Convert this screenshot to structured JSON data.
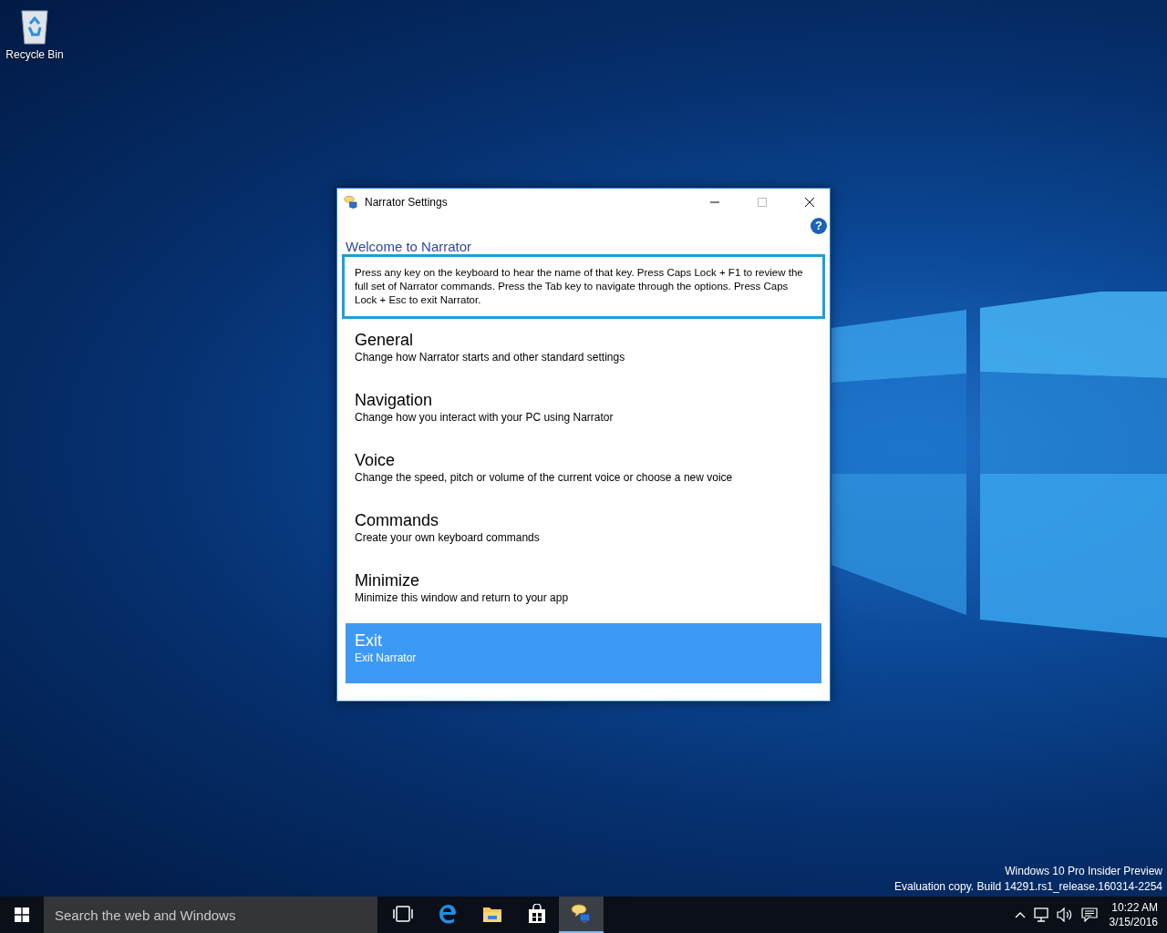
{
  "desktop": {
    "icons": [
      {
        "label": "Recycle Bin"
      }
    ],
    "build_info": [
      "Windows 10 Pro Insider Preview",
      "Evaluation copy. Build 14291.rs1_release.160314-2254"
    ]
  },
  "window": {
    "title": "Narrator Settings",
    "help_button": "?",
    "heading": "Welcome to Narrator",
    "intro": "Press any key on the keyboard to hear the name of that key.  Press Caps Lock + F1 to review the full set of Narrator commands.  Press the Tab key to navigate through the options.  Press Caps Lock + Esc to exit Narrator.",
    "items": [
      {
        "title": "General",
        "description": "Change how Narrator starts and other standard settings",
        "selected": false
      },
      {
        "title": "Navigation",
        "description": "Change how you interact with your PC using Narrator",
        "selected": false
      },
      {
        "title": "Voice",
        "description": "Change the speed, pitch or volume of the current voice or choose a new voice",
        "selected": false
      },
      {
        "title": "Commands",
        "description": "Create your own keyboard commands",
        "selected": false
      },
      {
        "title": "Minimize",
        "description": "Minimize this window and return to your app",
        "selected": false
      },
      {
        "title": "Exit",
        "description": "Exit Narrator",
        "selected": true
      }
    ]
  },
  "taskbar": {
    "search": {
      "placeholder": "Search the web and Windows"
    },
    "apps": [
      {
        "kind": "task-view",
        "selected": false
      },
      {
        "kind": "browser",
        "selected": false
      },
      {
        "kind": "folder",
        "selected": false
      },
      {
        "kind": "store",
        "selected": false
      },
      {
        "kind": "narrator",
        "selected": true
      }
    ],
    "clock": {
      "time": "10:22 AM",
      "date": "3/15/2016"
    }
  }
}
